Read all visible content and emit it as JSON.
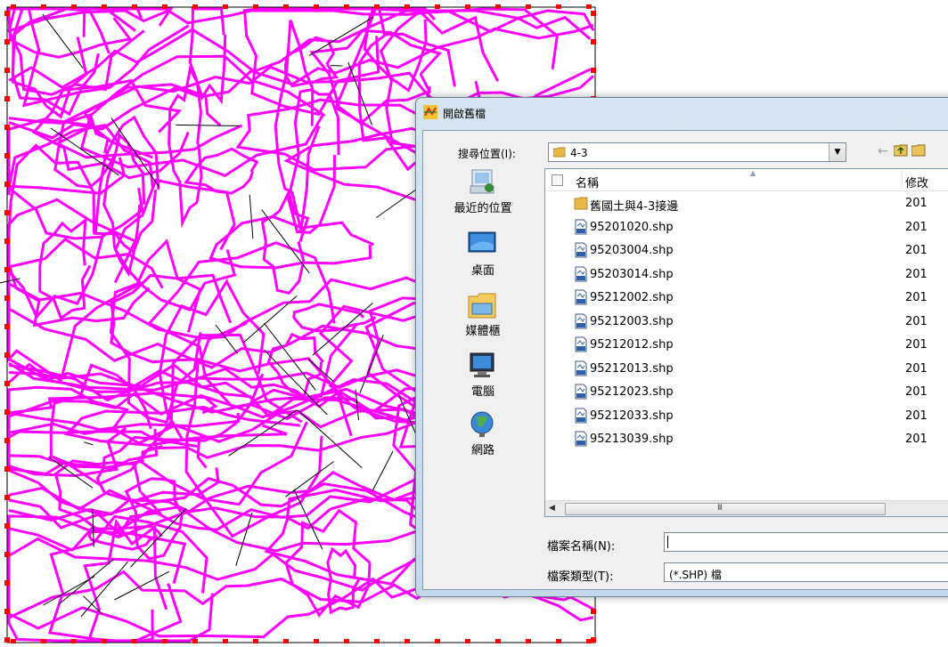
{
  "dialog": {
    "title": "開啟舊檔",
    "look_in_label": "搜尋位置(I):",
    "look_in_value": "4-3",
    "back_icon": "←",
    "places": [
      {
        "label": "最近的位置",
        "icon": "recent-places-icon"
      },
      {
        "label": "桌面",
        "icon": "desktop-icon"
      },
      {
        "label": "媒體櫃",
        "icon": "libraries-icon"
      },
      {
        "label": "電腦",
        "icon": "computer-icon"
      },
      {
        "label": "網路",
        "icon": "network-icon"
      }
    ],
    "columns": {
      "name": "名稱",
      "modified": "修改"
    },
    "files": [
      {
        "name": "舊國土與4-3接邊",
        "date": "201",
        "type": "folder"
      },
      {
        "name": "95201020.shp",
        "date": "201",
        "type": "shp"
      },
      {
        "name": "95203004.shp",
        "date": "201",
        "type": "shp"
      },
      {
        "name": "95203014.shp",
        "date": "201",
        "type": "shp"
      },
      {
        "name": "95212002.shp",
        "date": "201",
        "type": "shp"
      },
      {
        "name": "95212003.shp",
        "date": "201",
        "type": "shp"
      },
      {
        "name": "95212012.shp",
        "date": "201",
        "type": "shp"
      },
      {
        "name": "95212013.shp",
        "date": "201",
        "type": "shp"
      },
      {
        "name": "95212023.shp",
        "date": "201",
        "type": "shp"
      },
      {
        "name": "95212033.shp",
        "date": "201",
        "type": "shp"
      },
      {
        "name": "95213039.shp",
        "date": "201",
        "type": "shp"
      }
    ],
    "scroll_grip": "III",
    "file_name_label": "檔案名稱(N):",
    "file_name_value": "",
    "file_type_label": "檔案類型(T):",
    "file_type_value": "(*.SHP) 檔"
  },
  "colors": {
    "contour": "#ff00ff",
    "boundary": "#ff0000",
    "road": "#000000"
  }
}
